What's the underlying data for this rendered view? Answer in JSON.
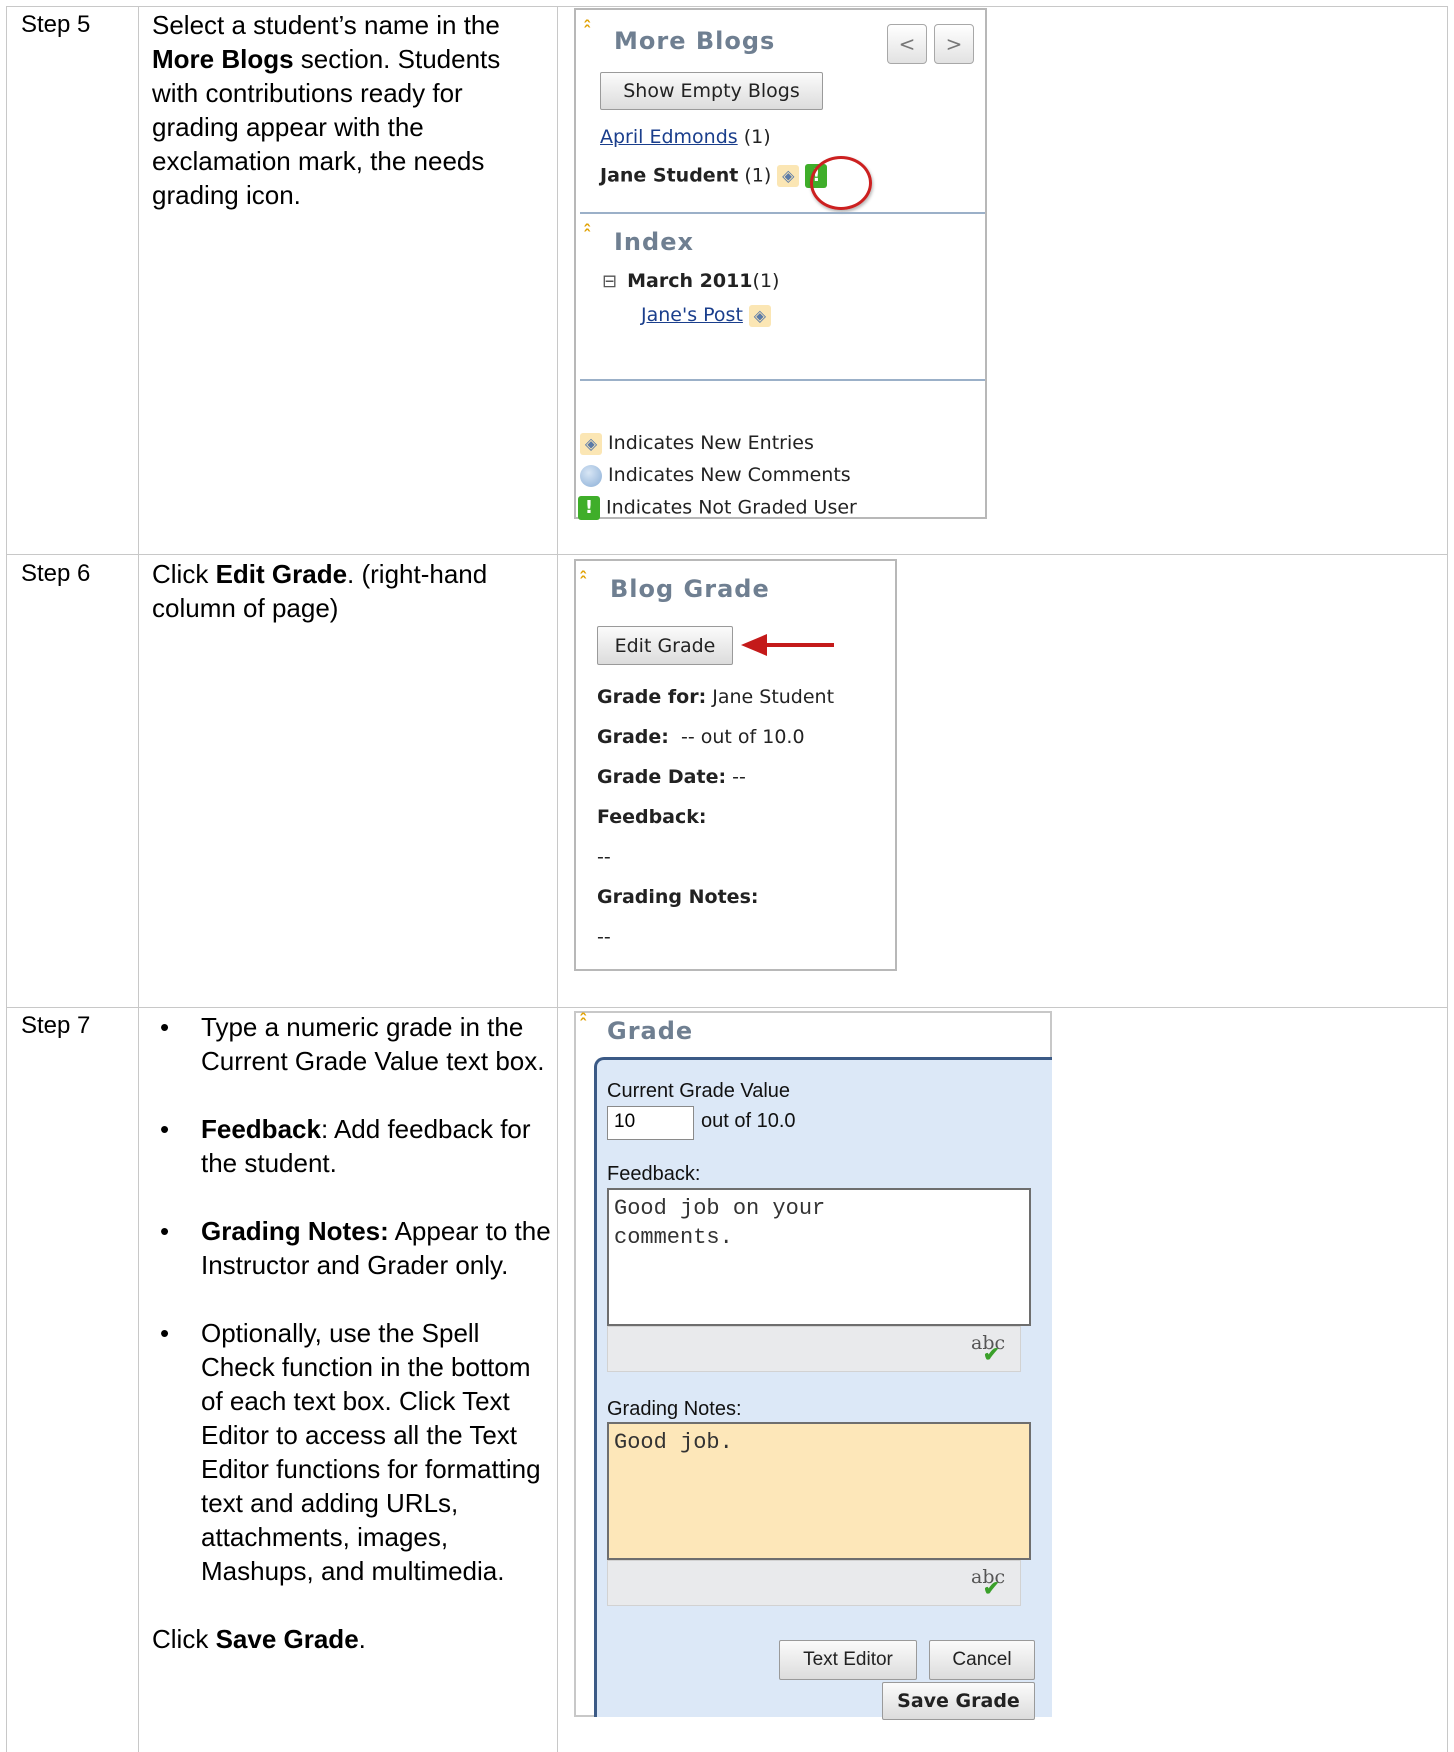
{
  "steps": [
    {
      "label": "Step 5",
      "text_a": "Select a student’s name in the ",
      "text_bold": "More Blogs",
      "text_b": " section. Students with contributions ready for grading appear with the exclamation mark, the needs grading icon."
    },
    {
      "label": "Step 6",
      "text_a": "Click ",
      "text_bold": "Edit Grade",
      "text_b": ". (right-hand column of page)"
    },
    {
      "label": "Step 7",
      "bullets": [
        {
          "bold": "",
          "text": "Type a numeric grade in the Current Grade Value text box."
        },
        {
          "bold": "Feedback",
          "text": ": Add feedback for the student."
        },
        {
          "bold": "Grading Notes:",
          "text": " Appear to the Instructor and Grader only."
        },
        {
          "bold": "",
          "text": "Optionally, use the Spell Check function in the bottom of each text box. Click Text Editor to access all the Text Editor functions for formatting text and adding URLs, attachments, images, Mashups, and multimedia."
        }
      ],
      "closing_a": "Click ",
      "closing_bold": "Save  Grade",
      "closing_b": "."
    }
  ],
  "bullet_glyph": "•",
  "more_blogs": {
    "title": "More Blogs",
    "prev_label": "<",
    "next_label": ">",
    "show_empty_label": "Show Empty Blogs",
    "users": [
      {
        "name": "April Edmonds",
        "count": "(1)"
      },
      {
        "name": "Jane Student",
        "count": "(1)"
      }
    ]
  },
  "index": {
    "title": "Index",
    "toggle": "⊟",
    "month": "March 2011",
    "month_count": "(1)",
    "post": "Jane's Post"
  },
  "legend": {
    "new_entries": "Indicates New Entries",
    "new_comments": "Indicates New Comments",
    "not_graded": "Indicates Not Graded User"
  },
  "blog_grade": {
    "title": "Blog Grade",
    "edit_label": "Edit Grade",
    "grade_for_label": "Grade for:",
    "grade_for_value": "Jane Student",
    "grade_label": "Grade:",
    "grade_value": "-- out of 10.0",
    "date_label": "Grade Date:",
    "date_value": "--",
    "feedback_label": "Feedback:",
    "feedback_value": "--",
    "notes_label": "Grading Notes:",
    "notes_value": "--"
  },
  "grade_form": {
    "title": "Grade",
    "current_label": "Current Grade Value",
    "current_value": "10",
    "out_of": "out of 10.0",
    "feedback_label": "Feedback:",
    "feedback_value": "Good job on your\ncomments.",
    "notes_label": "Grading Notes:",
    "notes_value": "Good job.",
    "spell_glyph": "abc",
    "check_glyph": "✔",
    "text_editor_label": "Text Editor",
    "cancel_label": "Cancel",
    "save_label": "Save Grade"
  },
  "colors": {
    "panel_title": "#6f7f91",
    "link": "#1a3e8c",
    "form_bg": "#dce8f7",
    "notes_bg": "#fde7b9",
    "grade_icon": "#3fae2a",
    "annotation_red": "#cc2020"
  },
  "icons": {
    "collapse": "double-chevron-up-icon",
    "new_entry": "new-entry-icon",
    "comment": "comment-bubble-icon",
    "not_graded": "exclamation-icon"
  }
}
